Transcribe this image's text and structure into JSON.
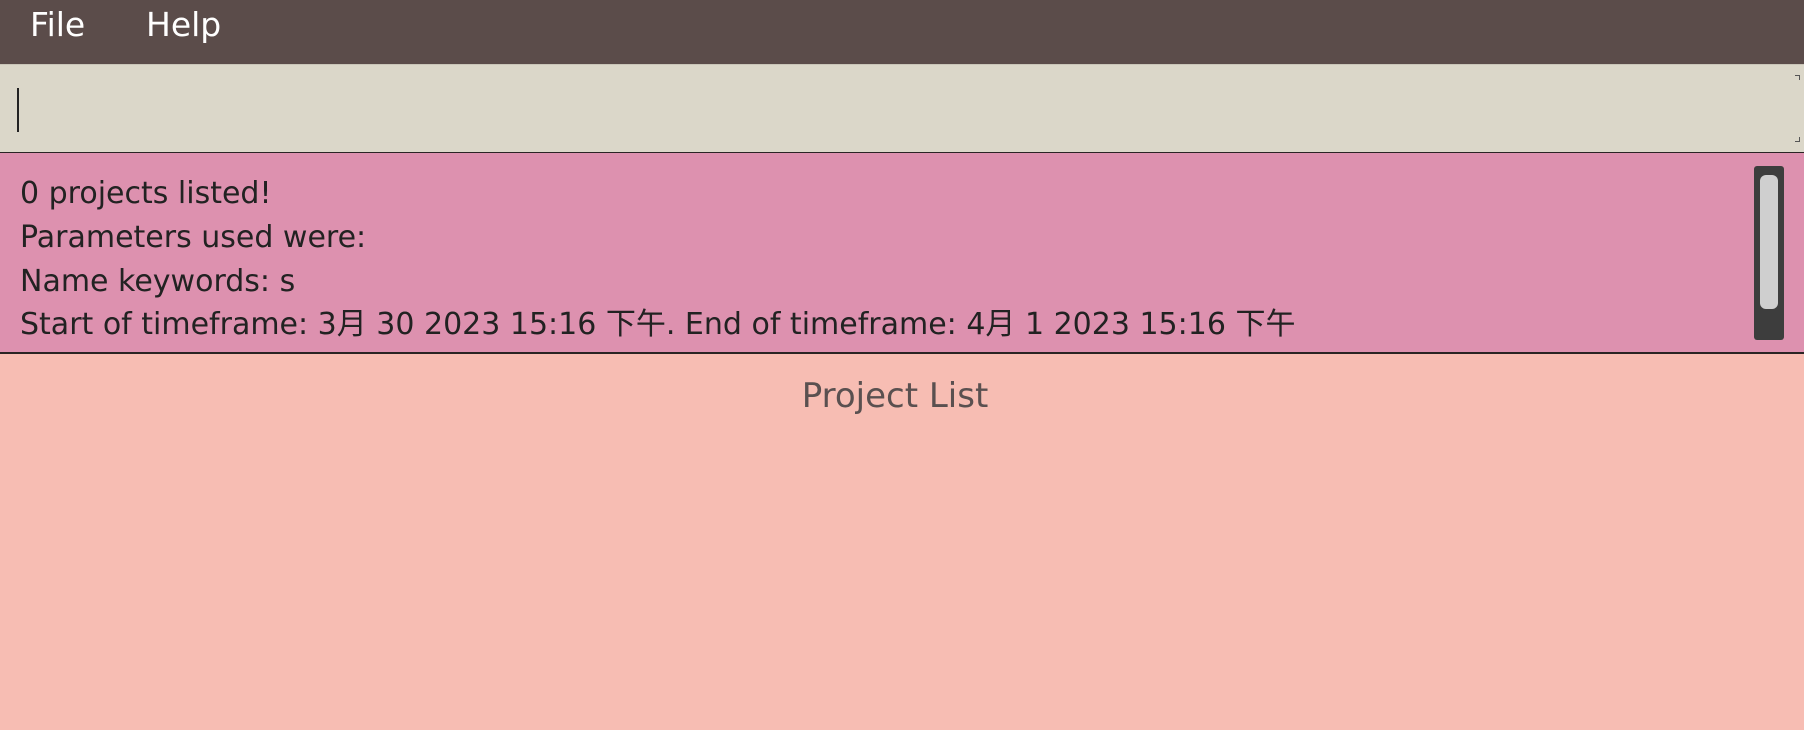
{
  "menu": {
    "file_label": "File",
    "help_label": "Help"
  },
  "command_box": {
    "value": "",
    "placeholder": ""
  },
  "result_display": {
    "lines": [
      "0 projects listed!",
      "Parameters used were:",
      "Name keywords: s",
      "Start of timeframe: 3月 30 2023 15:16 下午. End of timeframe: 4月 1 2023 15:16 下午"
    ]
  },
  "project_list": {
    "title": "Project List",
    "items": []
  },
  "colors": {
    "menubar": "#5b4c4a",
    "command_box": "#dbd7c9",
    "result_display": "#dd91af",
    "project_list": "#f7bdb3"
  }
}
